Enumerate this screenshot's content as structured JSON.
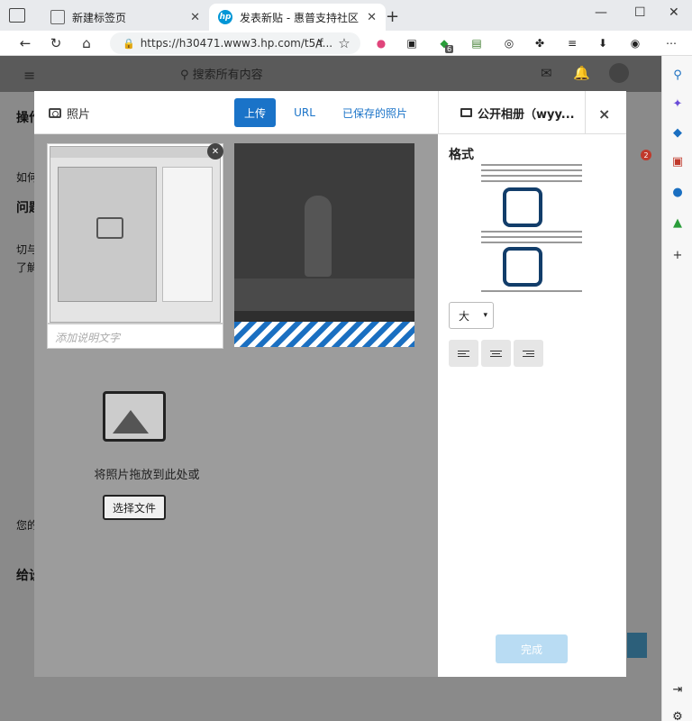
{
  "browser": {
    "tabs": [
      {
        "title": "新建标签页",
        "active": false
      },
      {
        "title": "发表新贴 - 惠普支持社区",
        "active": true
      }
    ],
    "address": "https://h30471.www3.hp.com/t5/f...",
    "extension_badge": "6",
    "sidebar_badge": "2"
  },
  "page": {
    "search_placeholder": "搜索所有内容",
    "fragments": [
      "操作",
      "如何",
      "问题",
      "切与",
      "了解",
      "您的",
      "给设"
    ]
  },
  "modal": {
    "title": "照片",
    "tabs": [
      "上传",
      "URL",
      "已保存的照片"
    ],
    "active_tab": "上传",
    "album": "公开相册（wyy...",
    "close": "×",
    "caption_placeholder": "添加说明文字",
    "drop_text": "将照片拖放到此处或",
    "choose_file": "选择文件",
    "format_label": "格式",
    "size_option": "大",
    "align_options": [
      "left-align-icon",
      "center-align-icon",
      "right-align-icon"
    ],
    "done_button": "完成",
    "accent_color": "#1a73c8"
  }
}
